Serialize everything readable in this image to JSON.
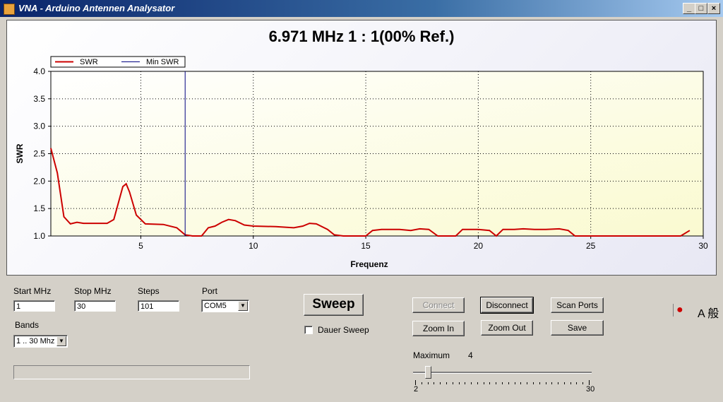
{
  "window": {
    "title": "VNA - Arduino Antennen Analysator",
    "minimize_glyph": "_",
    "maximize_glyph": "□",
    "close_glyph": "×"
  },
  "chart_data": {
    "type": "line",
    "title": "6.971 MHz   1 : 1(00% Ref.)",
    "xlabel": "Frequenz",
    "ylabel": "SWR",
    "xlim": [
      1,
      30
    ],
    "ylim": [
      1.0,
      4.0
    ],
    "xticks": [
      5,
      10,
      15,
      20,
      25,
      30
    ],
    "yticks": [
      1.0,
      1.5,
      2.0,
      2.5,
      3.0,
      3.5,
      4.0
    ],
    "grid": true,
    "legend_position": "top-left",
    "series": [
      {
        "name": "SWR",
        "color": "#cc0000",
        "x": [
          1.0,
          1.29,
          1.58,
          1.87,
          2.16,
          2.45,
          3.0,
          3.5,
          3.8,
          4.0,
          4.2,
          4.35,
          4.5,
          4.8,
          5.2,
          6.0,
          6.6,
          6.97,
          7.3,
          7.7,
          8.0,
          8.3,
          8.6,
          8.9,
          9.2,
          9.6,
          10.0,
          11.0,
          11.8,
          12.2,
          12.5,
          12.8,
          13.3,
          13.6,
          14.0,
          15.0,
          15.3,
          15.7,
          16.5,
          17.0,
          17.4,
          17.8,
          18.2,
          19.0,
          19.3,
          19.7,
          20.0,
          20.5,
          20.8,
          21.1,
          21.6,
          22.0,
          22.5,
          23.0,
          23.6,
          24.0,
          24.3,
          25.0,
          26.0,
          27.0,
          28.0,
          29.0,
          29.4
        ],
        "y": [
          2.6,
          2.15,
          1.35,
          1.22,
          1.25,
          1.23,
          1.23,
          1.23,
          1.3,
          1.6,
          1.9,
          1.95,
          1.8,
          1.38,
          1.22,
          1.21,
          1.15,
          1.02,
          1.0,
          1.0,
          1.15,
          1.18,
          1.25,
          1.3,
          1.28,
          1.2,
          1.18,
          1.17,
          1.15,
          1.18,
          1.23,
          1.22,
          1.12,
          1.02,
          1.0,
          1.0,
          1.1,
          1.12,
          1.12,
          1.1,
          1.13,
          1.12,
          1.0,
          1.0,
          1.12,
          1.12,
          1.12,
          1.1,
          1.0,
          1.12,
          1.12,
          1.13,
          1.12,
          1.12,
          1.13,
          1.1,
          1.0,
          1.0,
          1.0,
          1.0,
          1.0,
          1.0,
          1.1
        ]
      },
      {
        "name": "Min SWR",
        "color": "#000080",
        "x": [
          6.971,
          6.971
        ],
        "y": [
          1.0,
          4.0
        ]
      }
    ]
  },
  "settings": {
    "start_label": "Start MHz",
    "start_value": "1",
    "stop_label": "Stop MHz",
    "stop_value": "30",
    "steps_label": "Steps",
    "steps_value": "101",
    "port_label": "Port",
    "port_value": "COM5",
    "bands_label": "Bands",
    "bands_value": "1 .. 30 Mhz"
  },
  "sweep": {
    "button": "Sweep",
    "dauer_label": "Dauer Sweep",
    "dauer_checked": false
  },
  "buttons": {
    "connect": "Connect",
    "disconnect": "Disconnect",
    "scan_ports": "Scan Ports",
    "zoom_in": "Zoom In",
    "zoom_out": "Zoom Out",
    "save": "Save"
  },
  "maximum": {
    "label": "Maximum",
    "value": "4",
    "min_label": "2",
    "max_label": "30",
    "min": 2,
    "max": 30,
    "current": 4
  },
  "tray": {
    "ime_text": "A 般",
    "icon": "ime-icon"
  }
}
